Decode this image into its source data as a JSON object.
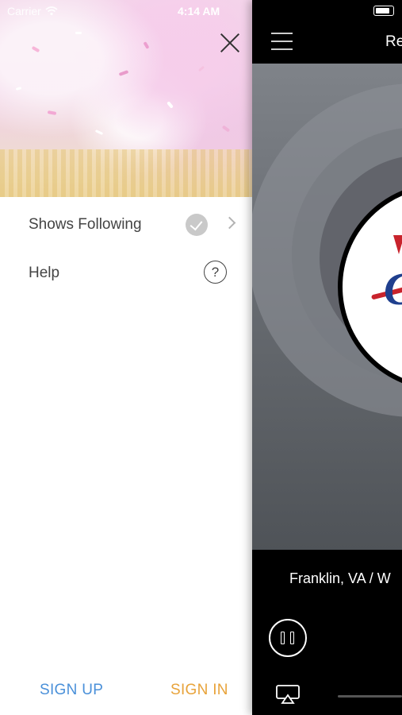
{
  "status_bar": {
    "carrier": "Carrier",
    "time": "4:14 AM"
  },
  "drawer": {
    "menu": [
      {
        "label": "Shows Following",
        "icon": "check-circle-icon",
        "trailing": "chevron-right-icon"
      },
      {
        "label": "Help",
        "icon": "help-circle-icon"
      }
    ],
    "help_glyph": "?",
    "signup_label": "SIGN UP",
    "signin_label": "SIGN IN",
    "colors": {
      "signup": "#4a90d9",
      "signin": "#e8a33a",
      "text": "#444444"
    }
  },
  "player": {
    "title": "Re",
    "location": "Franklin, VA / W",
    "colors": {
      "background": "#000000",
      "text": "#ffffff"
    }
  }
}
